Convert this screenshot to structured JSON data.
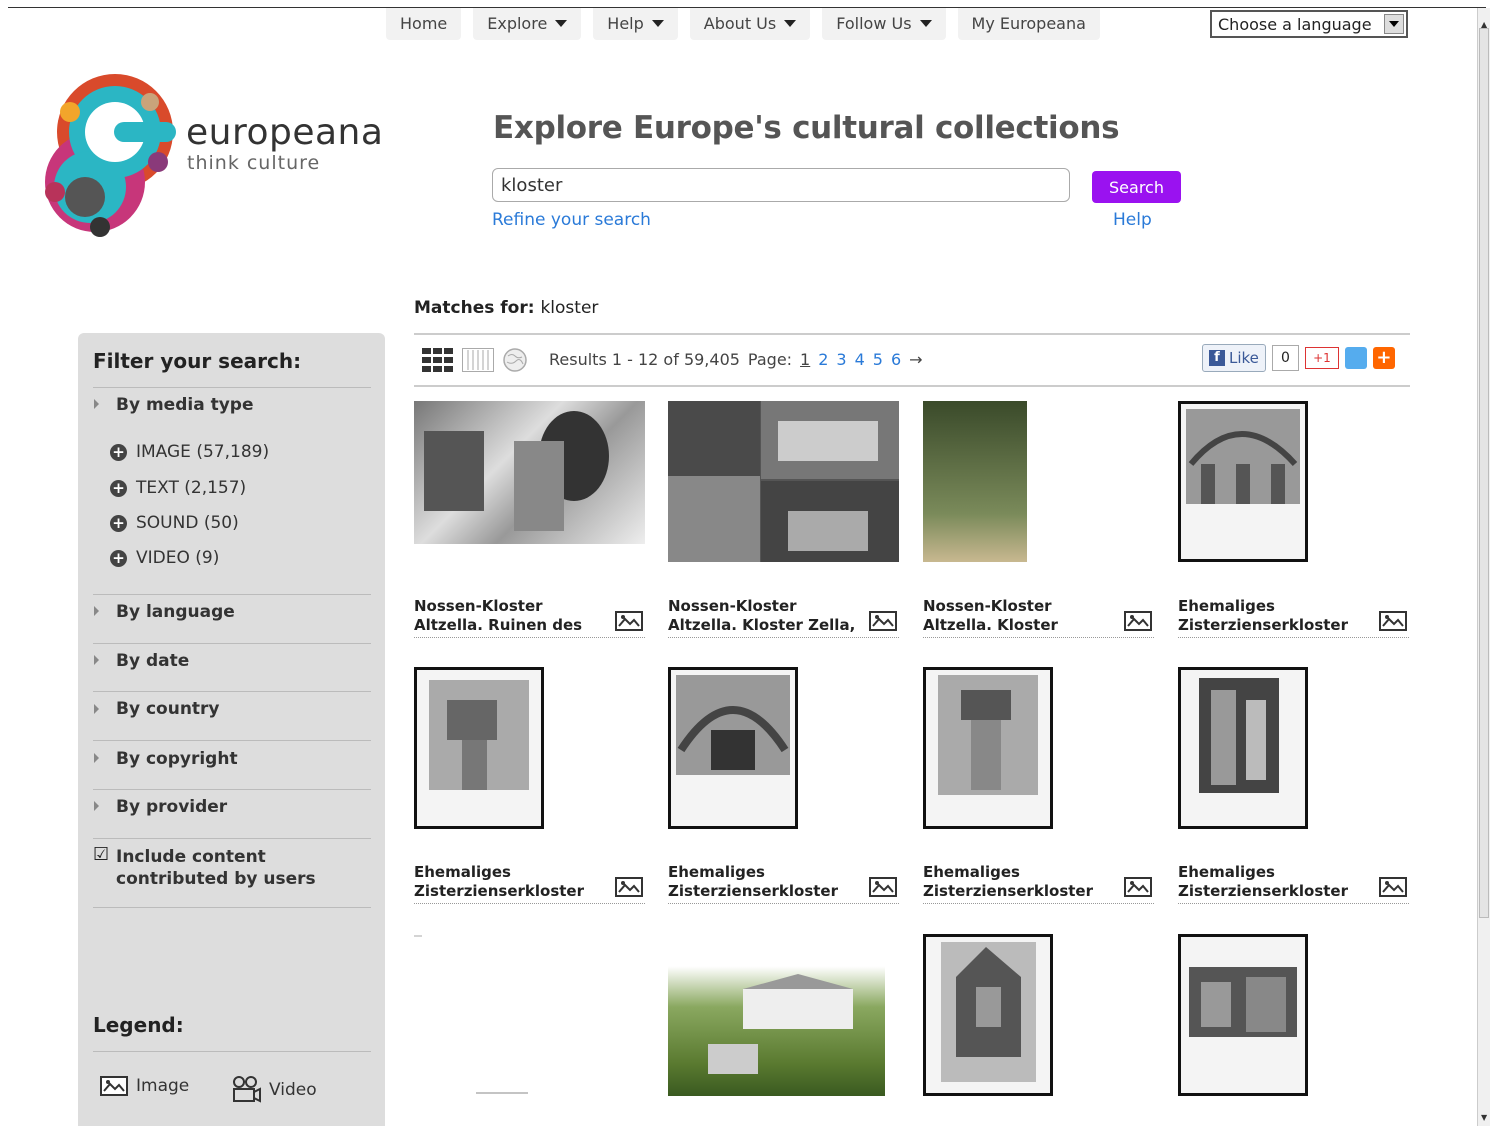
{
  "nav": {
    "items": [
      {
        "label": "Home",
        "dropdown": false
      },
      {
        "label": "Explore",
        "dropdown": true
      },
      {
        "label": "Help",
        "dropdown": true
      },
      {
        "label": "About Us",
        "dropdown": true
      },
      {
        "label": "Follow Us",
        "dropdown": true
      },
      {
        "label": "My Europeana",
        "dropdown": false
      }
    ],
    "language_select": "Choose a language"
  },
  "logo": {
    "word": "europeana",
    "tagline": "think culture"
  },
  "search": {
    "headline": "Explore Europe's cultural collections",
    "query": "kloster",
    "button": "Search",
    "refine": "Refine your search",
    "help": "Help"
  },
  "results": {
    "matches_label": "Matches for:",
    "matches_term": "kloster",
    "summary": "Results 1 - 12 of 59,405",
    "page_label": "Page:",
    "pages": [
      "1",
      "2",
      "3",
      "4",
      "5",
      "6"
    ],
    "next": "→",
    "like_label": "Like",
    "like_count": "0",
    "gplus_label": "+1"
  },
  "sidebar": {
    "title": "Filter your search:",
    "sections": {
      "media": "By media type",
      "language": "By language",
      "date": "By date",
      "country": "By country",
      "copyright": "By copyright",
      "provider": "By provider"
    },
    "media_options": [
      "IMAGE (57,189)",
      "TEXT (2,157)",
      "SOUND (50)",
      "VIDEO (9)"
    ],
    "include_label": "Include content contributed by users",
    "legend_title": "Legend:",
    "legend_image": "Image",
    "legend_video": "Video"
  },
  "items": [
    {
      "line1": "Nossen-Kloster",
      "line2": "Altzella. Ruinen des"
    },
    {
      "line1": "Nossen-Kloster",
      "line2": "Altzella. Kloster Zella,"
    },
    {
      "line1": "Nossen-Kloster",
      "line2": "Altzella. Kloster"
    },
    {
      "line1": "Ehemaliges",
      "line2": "Zisterzienserkloster"
    },
    {
      "line1": "Ehemaliges",
      "line2": "Zisterzienserkloster"
    },
    {
      "line1": "Ehemaliges",
      "line2": "Zisterzienserkloster"
    },
    {
      "line1": "Ehemaliges",
      "line2": "Zisterzienserkloster"
    },
    {
      "line1": "Ehemaliges",
      "line2": "Zisterzienserkloster"
    }
  ],
  "colors": {
    "accent": "#9a12f0",
    "link": "#2a7ad8"
  }
}
